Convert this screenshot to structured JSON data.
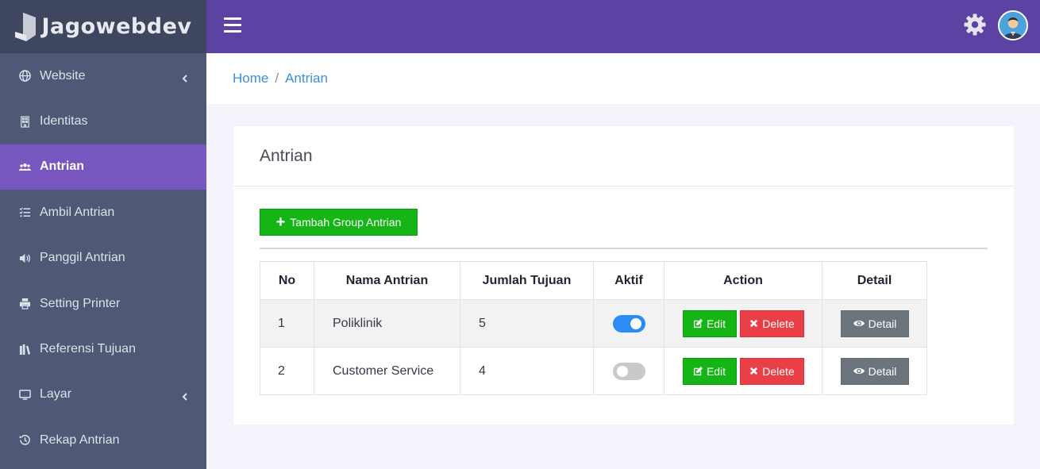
{
  "brand": {
    "name": "Jagowebdev"
  },
  "sidebar": {
    "items": [
      {
        "label": "Website",
        "icon": "globe-icon",
        "has_submenu": true
      },
      {
        "label": "Identitas",
        "icon": "building-icon",
        "has_submenu": false
      },
      {
        "label": "Antrian",
        "icon": "users-icon",
        "has_submenu": false,
        "active": true
      },
      {
        "label": "Ambil Antrian",
        "icon": "list-icon",
        "has_submenu": false
      },
      {
        "label": "Panggil Antrian",
        "icon": "volume-icon",
        "has_submenu": false
      },
      {
        "label": "Setting Printer",
        "icon": "printer-icon",
        "has_submenu": false
      },
      {
        "label": "Referensi Tujuan",
        "icon": "books-icon",
        "has_submenu": false
      },
      {
        "label": "Layar",
        "icon": "monitor-icon",
        "has_submenu": true
      },
      {
        "label": "Rekap Antrian",
        "icon": "history-icon",
        "has_submenu": false
      }
    ]
  },
  "header": {
    "menu_icon": "hamburger-icon",
    "settings_icon": "gear-icon",
    "avatar_icon": "user-avatar-icon"
  },
  "breadcrumb": {
    "home": "Home",
    "separator": "/",
    "current": "Antrian"
  },
  "card": {
    "title": "Antrian",
    "add_button": "Tambah Group Antrian"
  },
  "table": {
    "headers": {
      "no": "No",
      "name": "Nama Antrian",
      "count": "Jumlah Tujuan",
      "active": "Aktif",
      "action": "Action",
      "detail": "Detail"
    },
    "rows": [
      {
        "no": "1",
        "name": "Poliklinik",
        "count": "5",
        "active": true
      },
      {
        "no": "2",
        "name": "Customer Service",
        "count": "4",
        "active": false
      }
    ],
    "edit_label": "Edit",
    "delete_label": "Delete",
    "detail_label": "Detail"
  },
  "colors": {
    "sidebar_bg": "#4f5875",
    "header_bg": "#5c43a3",
    "active_item_bg": "#7657c0",
    "success": "#14b514",
    "danger": "#ea3f47",
    "secondary": "#6c757d",
    "toggle_on": "#2a8cf4",
    "link": "#3d8fd8"
  }
}
